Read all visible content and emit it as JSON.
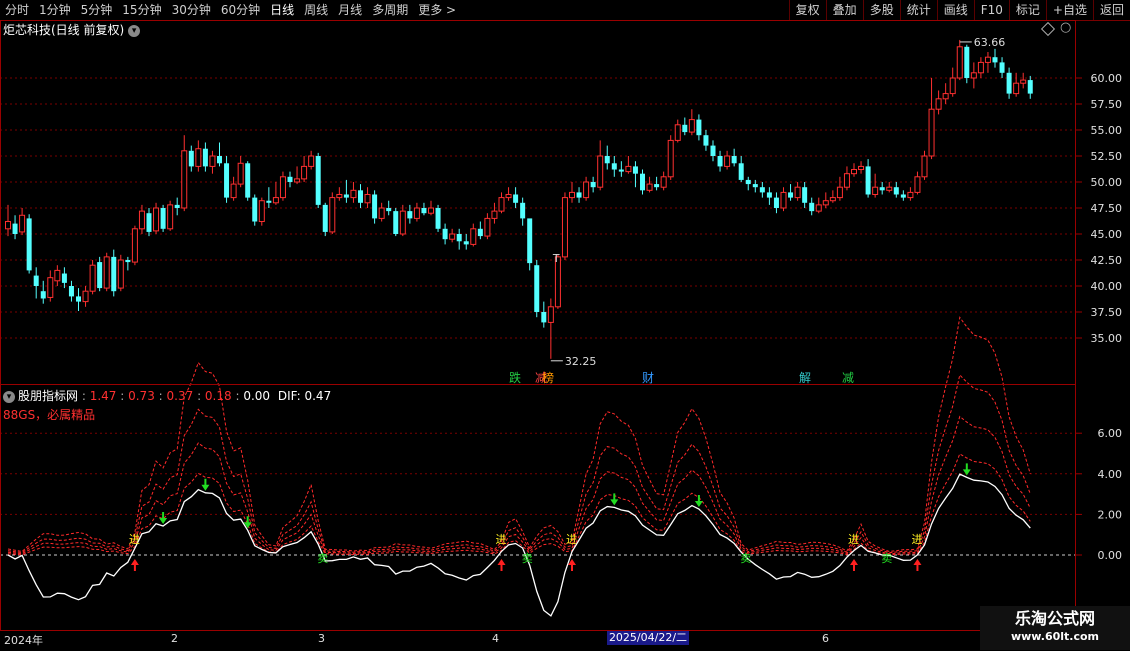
{
  "toolbar": {
    "timeframes": [
      "分时",
      "1分钟",
      "5分钟",
      "15分钟",
      "30分钟",
      "60分钟",
      "日线",
      "周线",
      "月线",
      "多周期",
      "更多 >"
    ],
    "active": "日线",
    "actions": [
      "复权",
      "叠加",
      "多股",
      "统计",
      "画线",
      "F10",
      "标记",
      "+自选",
      "返回"
    ]
  },
  "stock_title": "炬芯科技(日线 前复权)",
  "price_axis": [
    "60.00",
    "57.50",
    "55.00",
    "52.50",
    "50.00",
    "47.50",
    "45.00",
    "42.50",
    "40.00",
    "37.50",
    "35.00"
  ],
  "high_label": "63.66",
  "low_label": "32.25",
  "t_marker": "T",
  "event_tags": [
    {
      "text": "跌",
      "color": "#22cc44"
    },
    {
      "text": "减",
      "color": "#ff4444"
    },
    {
      "text": "榜",
      "color": "#ff9900"
    },
    {
      "text": "财",
      "color": "#3399ff"
    },
    {
      "text": "解",
      "color": "#33cccc"
    },
    {
      "text": "减",
      "color": "#22cc44"
    }
  ],
  "indicator": {
    "name": "股朋指标网",
    "values": [
      "1.47",
      "0.73",
      "0.37",
      "0.18",
      "0.00"
    ],
    "dif_label": "DIF: 0.47",
    "subtitle": "88GS，必属精品",
    "axis": [
      "6.00",
      "4.00",
      "2.00",
      "0.00"
    ],
    "buy_label": "进",
    "sell_label": "卖",
    "hold_label": "满"
  },
  "x_labels": [
    "2024年",
    "2",
    "3",
    "4",
    "6"
  ],
  "date_highlight": "2025/04/22/二",
  "logo": {
    "line1": "乐淘公式网",
    "line2": "www.60lt.com"
  },
  "colors": {
    "up": "#ff3030",
    "down": "#54ffff",
    "grid": "#7a0000",
    "dif": "#ffffff",
    "band": "#ff2a2a"
  },
  "chart_data": {
    "type": "candlestick",
    "ylim": [
      33,
      64
    ],
    "candles": [
      [
        45.5,
        46.2,
        47.8,
        44.8
      ],
      [
        46.0,
        45.0,
        46.8,
        44.5
      ],
      [
        45.2,
        46.8,
        47.5,
        44.9
      ],
      [
        46.5,
        41.5,
        46.9,
        41.2
      ],
      [
        41.0,
        40.0,
        41.8,
        38.8
      ],
      [
        39.5,
        38.8,
        40.5,
        38.3
      ],
      [
        38.9,
        40.8,
        41.5,
        38.5
      ],
      [
        40.5,
        41.5,
        42.0,
        40.0
      ],
      [
        41.2,
        40.3,
        41.8,
        39.8
      ],
      [
        40.0,
        39.0,
        40.5,
        38.5
      ],
      [
        39.0,
        38.5,
        39.8,
        37.6
      ],
      [
        38.5,
        39.5,
        40.0,
        38.0
      ],
      [
        39.5,
        42.0,
        42.5,
        39.2
      ],
      [
        42.3,
        39.8,
        42.8,
        39.5
      ],
      [
        39.8,
        42.8,
        43.2,
        39.5
      ],
      [
        42.8,
        39.5,
        43.5,
        39.0
      ],
      [
        39.8,
        42.5,
        43.0,
        39.5
      ],
      [
        42.5,
        42.3,
        42.8,
        41.5
      ],
      [
        42.3,
        45.5,
        45.8,
        42.0
      ],
      [
        45.5,
        47.2,
        47.8,
        45.0
      ],
      [
        47.0,
        45.2,
        47.5,
        44.8
      ],
      [
        45.3,
        47.5,
        48.0,
        45.0
      ],
      [
        47.5,
        45.5,
        47.8,
        45.2
      ],
      [
        45.5,
        47.8,
        48.2,
        45.3
      ],
      [
        47.8,
        47.5,
        48.5,
        46.8
      ],
      [
        47.5,
        53.0,
        54.5,
        47.2
      ],
      [
        53.0,
        51.5,
        53.5,
        51.0
      ],
      [
        51.5,
        53.2,
        54.0,
        51.0
      ],
      [
        53.2,
        51.5,
        53.8,
        51.0
      ],
      [
        51.5,
        52.5,
        53.0,
        50.8
      ],
      [
        52.5,
        51.8,
        53.8,
        51.5
      ],
      [
        51.8,
        48.5,
        52.5,
        48.0
      ],
      [
        48.5,
        49.8,
        50.5,
        48.2
      ],
      [
        49.8,
        51.8,
        52.5,
        49.5
      ],
      [
        51.8,
        48.5,
        52.0,
        48.2
      ],
      [
        48.5,
        46.2,
        48.8,
        45.8
      ],
      [
        46.2,
        48.2,
        48.5,
        45.8
      ],
      [
        48.2,
        48.0,
        49.5,
        47.5
      ],
      [
        48.0,
        48.5,
        50.0,
        47.8
      ],
      [
        48.5,
        50.5,
        51.0,
        48.2
      ],
      [
        50.5,
        50.0,
        51.0,
        49.5
      ],
      [
        50.0,
        50.3,
        51.5,
        49.8
      ],
      [
        50.3,
        51.5,
        52.5,
        50.0
      ],
      [
        51.5,
        52.5,
        53.0,
        51.2
      ],
      [
        52.5,
        47.8,
        52.8,
        47.5
      ],
      [
        47.8,
        45.2,
        48.0,
        44.8
      ],
      [
        45.2,
        48.5,
        49.0,
        45.0
      ],
      [
        48.5,
        48.8,
        49.5,
        48.2
      ],
      [
        48.8,
        48.5,
        50.2,
        48.0
      ],
      [
        48.5,
        49.2,
        50.0,
        48.0
      ],
      [
        49.2,
        48.0,
        49.8,
        47.5
      ],
      [
        48.0,
        48.8,
        49.5,
        47.5
      ],
      [
        48.8,
        46.5,
        49.2,
        46.0
      ],
      [
        46.5,
        47.5,
        48.0,
        46.2
      ],
      [
        47.5,
        47.2,
        48.2,
        46.8
      ],
      [
        47.2,
        45.0,
        47.5,
        44.8
      ],
      [
        45.0,
        47.2,
        47.8,
        44.8
      ],
      [
        47.2,
        46.5,
        47.8,
        46.0
      ],
      [
        46.5,
        47.5,
        48.0,
        46.2
      ],
      [
        47.5,
        47.0,
        48.0,
        46.8
      ],
      [
        47.0,
        47.5,
        48.2,
        46.8
      ],
      [
        47.5,
        45.5,
        47.8,
        45.2
      ],
      [
        45.5,
        44.5,
        46.0,
        44.0
      ],
      [
        44.5,
        45.0,
        45.5,
        44.2
      ],
      [
        45.0,
        44.3,
        45.5,
        43.5
      ],
      [
        44.3,
        44.0,
        45.0,
        43.5
      ],
      [
        44.0,
        45.5,
        46.0,
        43.8
      ],
      [
        45.5,
        44.8,
        46.2,
        44.5
      ],
      [
        44.8,
        46.5,
        47.0,
        44.5
      ],
      [
        46.5,
        47.2,
        48.0,
        46.0
      ],
      [
        47.2,
        48.5,
        49.0,
        47.0
      ],
      [
        48.5,
        48.8,
        49.5,
        48.2
      ],
      [
        48.8,
        48.0,
        49.5,
        47.5
      ],
      [
        48.0,
        46.5,
        48.5,
        45.8
      ],
      [
        46.5,
        42.2,
        42.8,
        41.5
      ],
      [
        42.0,
        37.5,
        42.5,
        37.0
      ],
      [
        37.5,
        36.5,
        38.5,
        36.0
      ],
      [
        36.5,
        38.0,
        38.8,
        33.0
      ],
      [
        38.0,
        42.8,
        43.0,
        37.8
      ],
      [
        42.8,
        48.5,
        49.0,
        42.5
      ],
      [
        48.5,
        49.0,
        50.0,
        48.0
      ],
      [
        49.0,
        48.5,
        49.5,
        48.0
      ],
      [
        48.5,
        50.0,
        50.5,
        48.2
      ],
      [
        50.0,
        49.5,
        50.5,
        49.0
      ],
      [
        49.5,
        52.5,
        54.0,
        49.2
      ],
      [
        52.5,
        51.8,
        53.5,
        51.2
      ],
      [
        51.8,
        51.2,
        52.5,
        50.5
      ],
      [
        51.2,
        51.0,
        52.0,
        50.5
      ],
      [
        51.0,
        51.5,
        52.5,
        50.8
      ],
      [
        51.5,
        50.8,
        52.0,
        49.5
      ],
      [
        50.8,
        49.2,
        51.2,
        48.8
      ],
      [
        49.2,
        49.8,
        50.5,
        49.0
      ],
      [
        49.8,
        49.5,
        50.5,
        49.2
      ],
      [
        49.5,
        50.5,
        51.0,
        49.2
      ],
      [
        50.5,
        54.0,
        54.5,
        50.2
      ],
      [
        54.0,
        55.5,
        56.0,
        53.8
      ],
      [
        55.5,
        54.8,
        56.2,
        54.5
      ],
      [
        54.8,
        56.0,
        57.0,
        54.5
      ],
      [
        56.0,
        54.5,
        56.5,
        54.0
      ],
      [
        54.5,
        53.5,
        55.0,
        53.0
      ],
      [
        53.5,
        52.5,
        54.0,
        52.0
      ],
      [
        52.5,
        51.5,
        53.0,
        51.0
      ],
      [
        51.5,
        52.5,
        53.0,
        51.2
      ],
      [
        52.5,
        51.8,
        53.2,
        51.5
      ],
      [
        51.8,
        50.2,
        52.5,
        50.0
      ],
      [
        50.2,
        49.8,
        50.5,
        49.2
      ],
      [
        49.8,
        49.5,
        50.2,
        49.0
      ],
      [
        49.5,
        49.0,
        50.0,
        48.5
      ],
      [
        49.0,
        48.5,
        49.5,
        47.8
      ],
      [
        48.5,
        47.5,
        49.0,
        47.0
      ],
      [
        47.5,
        49.0,
        49.5,
        47.2
      ],
      [
        49.0,
        48.5,
        49.8,
        48.2
      ],
      [
        48.5,
        49.5,
        50.0,
        48.2
      ],
      [
        49.5,
        48.0,
        50.0,
        47.5
      ],
      [
        48.0,
        47.2,
        48.5,
        46.8
      ],
      [
        47.2,
        47.8,
        48.5,
        47.0
      ],
      [
        47.8,
        48.2,
        49.0,
        47.5
      ],
      [
        48.2,
        48.5,
        49.2,
        48.0
      ],
      [
        48.5,
        49.5,
        50.5,
        48.2
      ],
      [
        49.5,
        50.8,
        51.5,
        49.2
      ],
      [
        50.8,
        51.2,
        51.8,
        50.5
      ],
      [
        51.2,
        51.5,
        52.0,
        50.8
      ],
      [
        51.5,
        48.8,
        52.2,
        48.5
      ],
      [
        48.8,
        49.5,
        50.8,
        48.5
      ],
      [
        49.5,
        49.2,
        50.0,
        48.8
      ],
      [
        49.2,
        49.5,
        50.0,
        49.0
      ],
      [
        49.5,
        48.8,
        50.0,
        48.5
      ],
      [
        48.8,
        48.5,
        49.2,
        48.2
      ],
      [
        48.5,
        49.0,
        49.5,
        48.2
      ],
      [
        49.0,
        50.5,
        51.0,
        48.8
      ],
      [
        50.5,
        52.5,
        53.0,
        50.2
      ],
      [
        52.5,
        57.0,
        60.0,
        52.2
      ],
      [
        57.0,
        58.0,
        58.8,
        56.5
      ],
      [
        58.0,
        58.5,
        59.5,
        57.5
      ],
      [
        58.5,
        60.0,
        61.0,
        58.2
      ],
      [
        60.0,
        63.0,
        63.66,
        59.8
      ],
      [
        63.0,
        60.0,
        63.2,
        59.5
      ],
      [
        60.0,
        60.5,
        61.5,
        59.0
      ],
      [
        60.5,
        61.5,
        62.0,
        60.0
      ],
      [
        61.5,
        62.0,
        62.5,
        60.5
      ],
      [
        62.0,
        61.5,
        62.8,
        61.0
      ],
      [
        61.5,
        60.5,
        62.0,
        60.0
      ],
      [
        60.5,
        58.5,
        61.0,
        58.0
      ],
      [
        58.5,
        59.5,
        60.5,
        58.2
      ],
      [
        59.5,
        59.8,
        60.5,
        59.0
      ],
      [
        59.8,
        58.5,
        60.2,
        58.0
      ]
    ]
  }
}
